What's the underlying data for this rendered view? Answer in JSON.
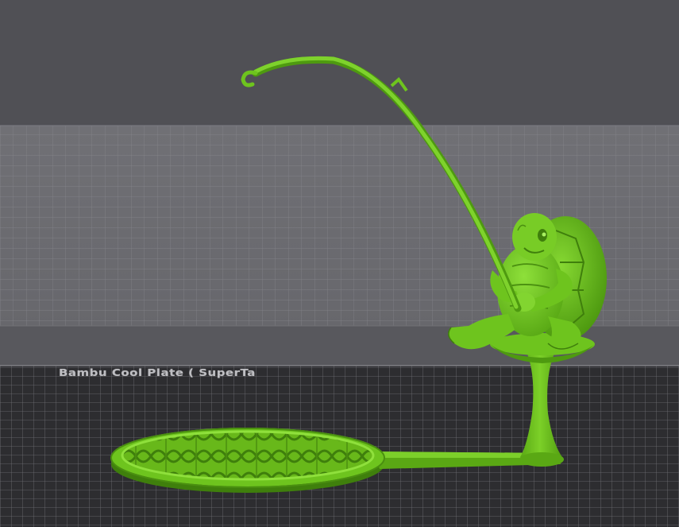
{
  "viewport": {
    "plate_label": "Bambu Cool Plate ( SuperTa",
    "model_name": "fishing-turtle",
    "model_color": "#6ec41e"
  },
  "colors": {
    "background_top": "#505055",
    "back_wall": "#6b6b70",
    "bed_surface": "#2d2d30",
    "grid_line": "#8a8a90",
    "model_green": "#6ec41e",
    "model_dark": "#3f7f0c"
  }
}
